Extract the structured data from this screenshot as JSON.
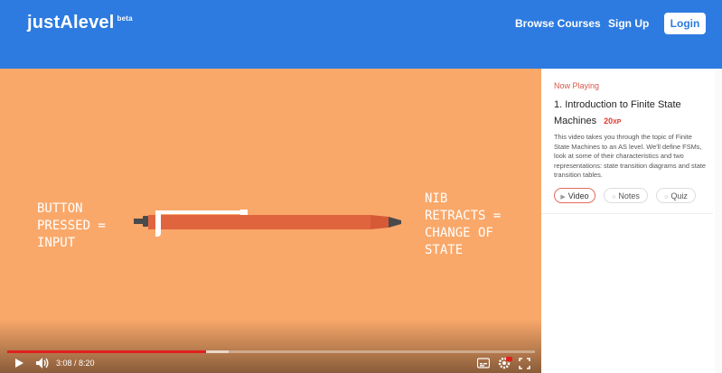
{
  "header": {
    "logo": "justAlevel",
    "logo_badge": "beta",
    "nav": {
      "browse": "Browse Courses",
      "signup": "Sign Up",
      "login": "Login"
    },
    "color": "#2d7be0"
  },
  "video": {
    "background": "#f9a86a",
    "caption_left": "BUTTON\nPRESSED =\nINPUT",
    "caption_right": "NIB\nRETRACTS =\nCHANGE OF\nSTATE",
    "current_time": "3:08",
    "duration": "8:20",
    "time_display": "3:08 / 8:20",
    "played_fraction": 0.376,
    "buffered_fraction": 0.42,
    "icons": [
      "play-icon",
      "volume-icon",
      "captions-icon",
      "settings-gear-icon",
      "fullscreen-icon"
    ]
  },
  "panel": {
    "now_playing": "Now Playing",
    "title": "1. Introduction to Finite State Machines",
    "xp_value": "20",
    "xp_unit": "XP",
    "description": "This video takes you through the topic of Finite State Machines to an AS level. We'll define FSMs, look at some of their characteristics and two representations: state transition diagrams and state transition tables.",
    "tabs": [
      {
        "label": "Video",
        "icon": "play-small-icon",
        "active": true
      },
      {
        "label": "Notes",
        "icon": "circle-icon",
        "active": false
      },
      {
        "label": "Quiz",
        "icon": "circle-icon",
        "active": false
      }
    ]
  }
}
